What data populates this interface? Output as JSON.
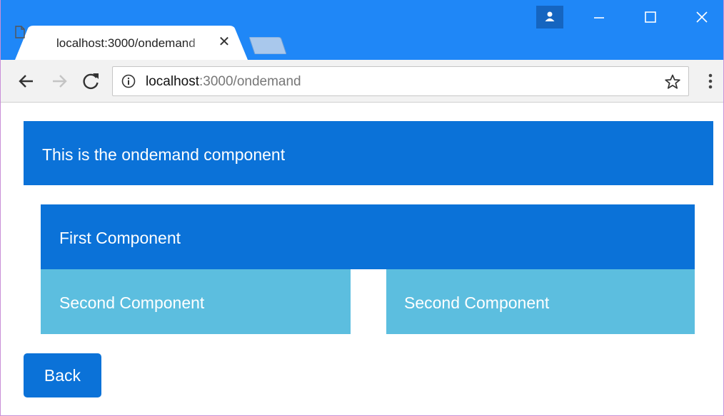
{
  "browser": {
    "tab": {
      "title": "localhost:3000/ondemand",
      "close_glyph": "✕"
    },
    "url": {
      "host": "localhost",
      "rest": ":3000/ondemand"
    },
    "window_controls": [
      "profile-icon",
      "minimize-icon",
      "maximize-icon",
      "close-icon"
    ],
    "toolbar_icons": [
      "back-arrow-icon",
      "forward-arrow-icon",
      "reload-icon",
      "info-icon",
      "star-icon",
      "menu-icon"
    ],
    "colors": {
      "titlebar": "#1f87f7",
      "toolbar": "#f2f2f2"
    }
  },
  "page": {
    "ondemand_text": "This is the ondemand component",
    "first_text": "First Component",
    "second_components": [
      "Second Component",
      "Second Component"
    ],
    "back_label": "Back",
    "colors": {
      "primary": "#0b72d8",
      "info": "#5cbedf",
      "text": "#ffffff"
    }
  }
}
